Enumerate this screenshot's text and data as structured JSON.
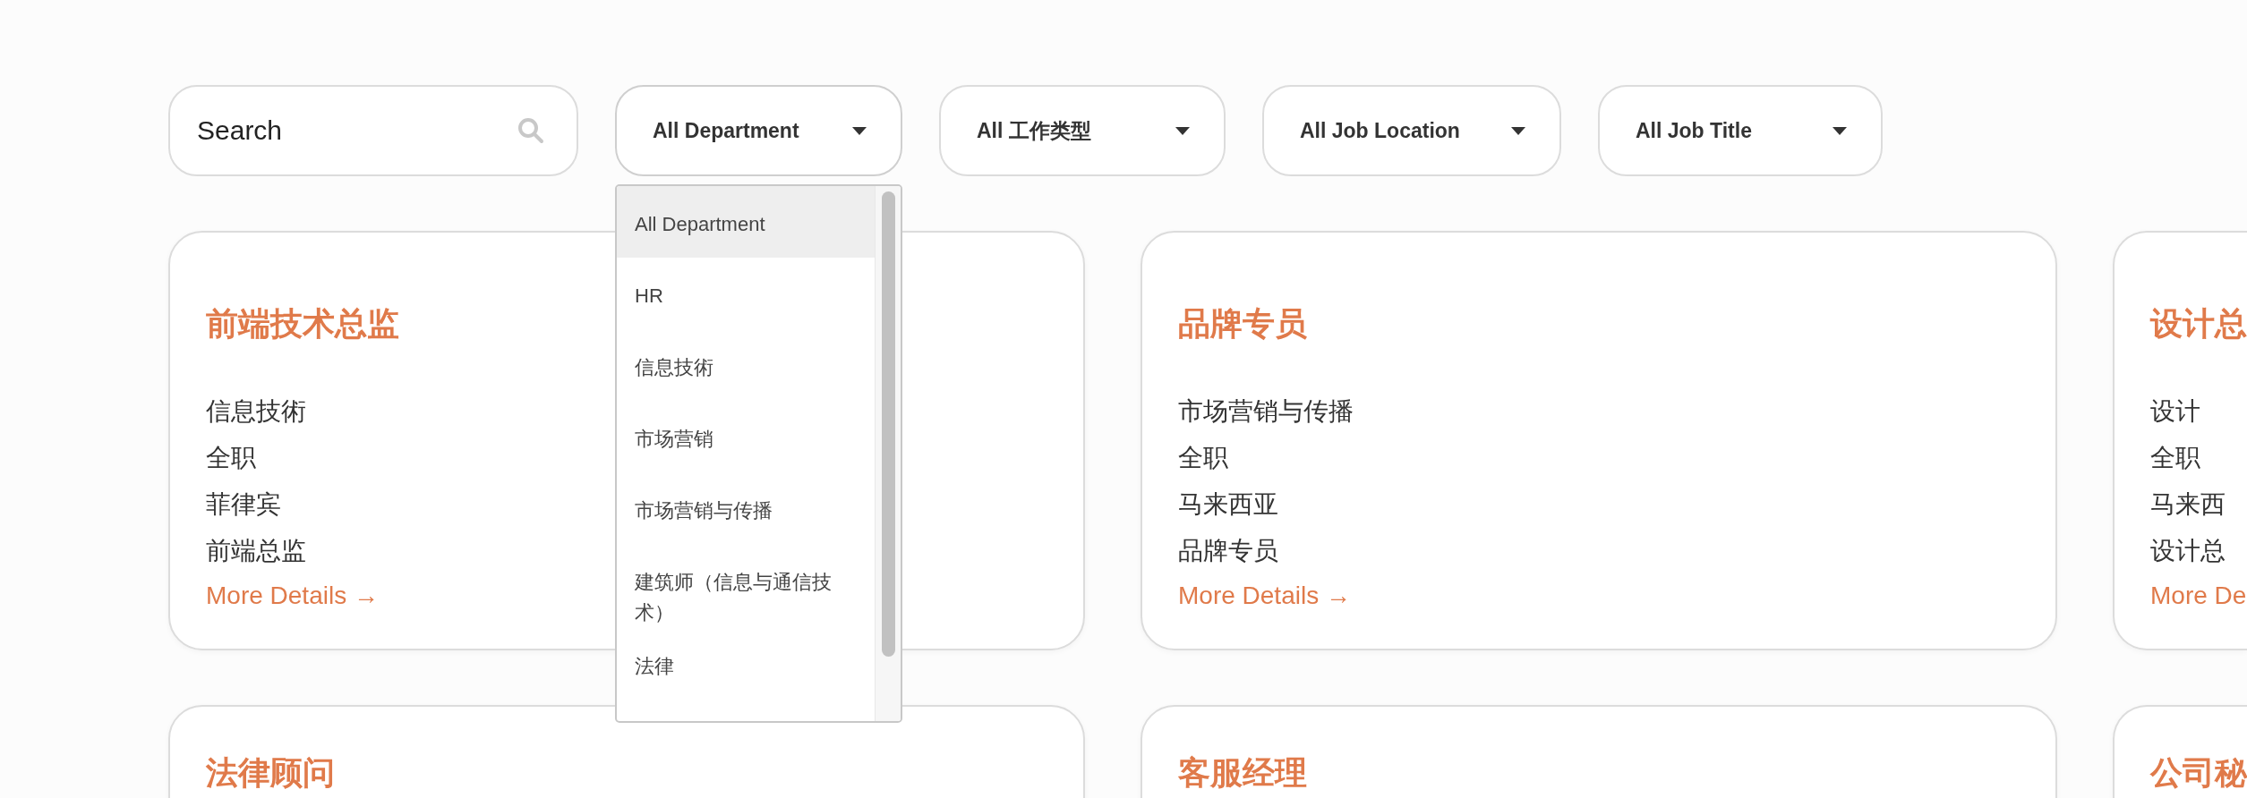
{
  "search": {
    "placeholder": "Search"
  },
  "filters": [
    {
      "label": "All Department",
      "expanded": true,
      "options": [
        {
          "label": "All Department",
          "selected": true
        },
        {
          "label": "HR",
          "selected": false
        },
        {
          "label": "信息技術",
          "selected": false
        },
        {
          "label": "市场营销",
          "selected": false
        },
        {
          "label": "市场营销与传播",
          "selected": false
        },
        {
          "label": "建筑师（信息与通信技术）",
          "selected": false
        },
        {
          "label": "法律",
          "selected": false
        }
      ]
    },
    {
      "label": "All 工作类型",
      "expanded": false
    },
    {
      "label": "All Job Location",
      "expanded": false
    },
    {
      "label": "All Job Title",
      "expanded": false
    }
  ],
  "jobs": [
    {
      "title": "前端技术总监",
      "details": [
        "信息技術",
        "全职",
        "菲律宾",
        "前端总监"
      ],
      "link": "More Details →"
    },
    {
      "title": "品牌专员",
      "details": [
        "市场营销与传播",
        "全职",
        "马来西亚",
        "品牌专员"
      ],
      "link": "More Details →"
    },
    {
      "title": "设计总",
      "details": [
        "设计",
        "全职",
        "马来西",
        "设计总"
      ],
      "link": "More De"
    },
    {
      "title": "法律顾问"
    },
    {
      "title": "客服经理"
    },
    {
      "title": "公司秘"
    }
  ]
}
